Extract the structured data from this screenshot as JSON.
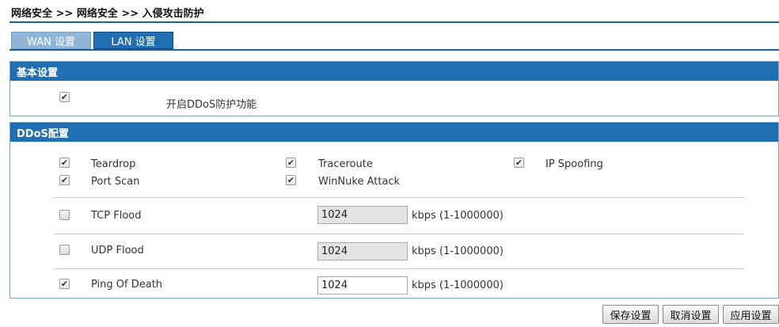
{
  "breadcrumb": "网络安全 >> 网络安全 >> 入侵攻击防护",
  "tabs": [
    {
      "label": "WAN 设置",
      "active": false
    },
    {
      "label": "LAN 设置",
      "active": true
    }
  ],
  "basic": {
    "header": "基本设置",
    "ddos_enable": {
      "label": "开启DDoS防护功能",
      "checked": true
    }
  },
  "ddos": {
    "header": "DDoS配置",
    "attacks": [
      {
        "label": "Teardrop",
        "checked": true
      },
      {
        "label": "Traceroute",
        "checked": true
      },
      {
        "label": "IP Spoofing",
        "checked": true
      },
      {
        "label": "Port Scan",
        "checked": true
      },
      {
        "label": "WinNuke Attack",
        "checked": true
      }
    ],
    "floods": [
      {
        "label": "TCP Flood",
        "checked": false,
        "value": "1024",
        "unit": "kbps (1-1000000)",
        "enabled": false
      },
      {
        "label": "UDP Flood",
        "checked": false,
        "value": "1024",
        "unit": "kbps (1-1000000)",
        "enabled": false
      },
      {
        "label": "Ping Of Death",
        "checked": true,
        "value": "1024",
        "unit": "kbps (1-1000000)",
        "enabled": true
      }
    ]
  },
  "buttons": {
    "save": "保存设置",
    "cancel": "取消设置",
    "apply": "应用设置"
  },
  "check_glyph": "✔"
}
